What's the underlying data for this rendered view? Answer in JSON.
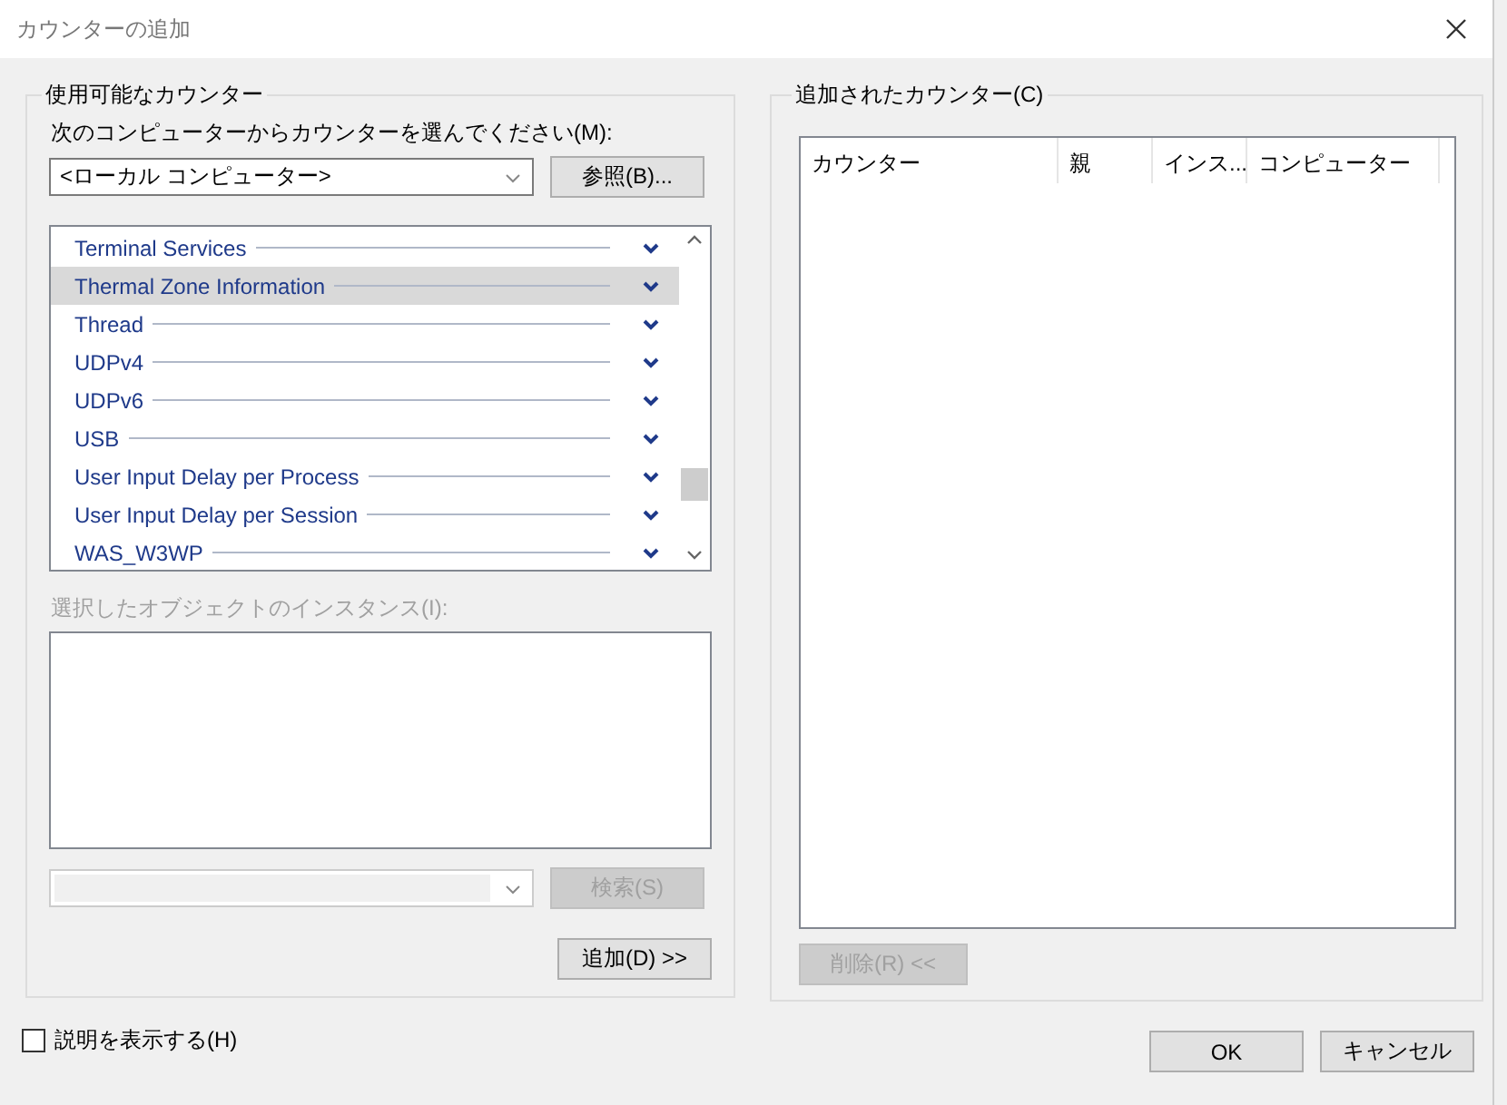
{
  "window": {
    "title": "カウンターの追加"
  },
  "available": {
    "legend": "使用可能なカウンター",
    "computer_label": "次のコンピューターからカウンターを選んでください(M):",
    "computer": {
      "value": "<ローカル コンピューター>"
    },
    "browse_button": "参照(B)...",
    "objects": [
      {
        "name": "Terminal Services",
        "selected": false
      },
      {
        "name": "Thermal Zone Information",
        "selected": true
      },
      {
        "name": "Thread",
        "selected": false
      },
      {
        "name": "UDPv4",
        "selected": false
      },
      {
        "name": "UDPv6",
        "selected": false
      },
      {
        "name": "USB",
        "selected": false
      },
      {
        "name": "User Input Delay per Process",
        "selected": false
      },
      {
        "name": "User Input Delay per Session",
        "selected": false
      },
      {
        "name": "WAS_W3WP",
        "selected": false
      }
    ],
    "instances": {
      "label": "選択したオブジェクトのインスタンス(I):",
      "disabled": true
    },
    "search": {
      "button": "検索(S)",
      "disabled": true
    },
    "add_button": "追加(D) >>"
  },
  "added": {
    "legend": "追加されたカウンター(C)",
    "columns": [
      "カウンター",
      "親",
      "インス...",
      "コンピューター"
    ],
    "remove_button": {
      "label": "削除(R) <<",
      "disabled": true
    }
  },
  "show_description": {
    "label": "説明を表示する(H)",
    "checked": false
  },
  "buttons": [
    "OK",
    "キャンセル"
  ]
}
